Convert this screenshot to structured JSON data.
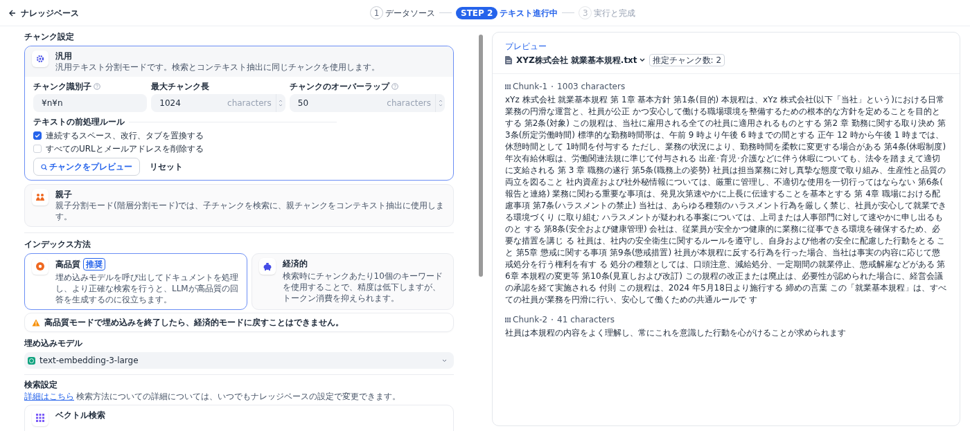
{
  "header": {
    "back_label": "ナレッジベース",
    "steps": [
      {
        "number": "1",
        "label": "データソース",
        "selected": false,
        "disabled": false
      },
      {
        "number": "STEP 2",
        "label": "テキスト進行中",
        "selected": true,
        "disabled": false
      },
      {
        "number": "3",
        "label": "実行と完成",
        "selected": false,
        "disabled": true
      }
    ]
  },
  "chunk_settings": {
    "title": "チャンク設定",
    "modes": [
      {
        "kind": "general",
        "title": "汎用",
        "description": "汎用テキスト分割モードです。検索とコンテキスト抽出に同じチャンクを使用します。",
        "selected": true,
        "fields": [
          {
            "label": "チャンク識別子",
            "help_icon": true,
            "value": "¥n¥n"
          },
          {
            "label": "最大チャンク長",
            "help_icon": false,
            "value": "1024",
            "unit": "characters"
          },
          {
            "label": "チャンクのオーバーラップ",
            "help_icon": true,
            "value": "50",
            "unit": "characters"
          }
        ],
        "rules_title": "テキストの前処理ルール",
        "rules": [
          {
            "label": "連続するスペース、改行、タブを置換する",
            "checked": true
          },
          {
            "label": "すべてのURLとメールアドレスを削除する",
            "checked": false
          }
        ],
        "preview_button": "チャンクをプレビュー",
        "reset_button": "リセット"
      },
      {
        "kind": "parent",
        "title": "親子",
        "description": "親子分割モード(階層分割モード)では、子チャンクを検索に、親チャンクをコンテキスト抽出に使用します。",
        "selected": false
      }
    ]
  },
  "index_method": {
    "title": "インデックス方法",
    "options": [
      {
        "kind": "high_quality",
        "title": "高品質",
        "badge": "推奨",
        "description": "埋め込みモデルを呼び出してドキュメントを処理し、より正確な検索を行うと、LLMが高品質の回答を生成するのに役立ちます。",
        "selected": true
      },
      {
        "kind": "economy",
        "title": "経済的",
        "description": "検索時にチャンクあたり10個のキーワードを使用することで、精度は低下しますが、トークン消費を抑えられます。",
        "selected": false
      }
    ],
    "warning": "高品質モードで埋め込みを終了したら、経済的モードに戻すことはできません。"
  },
  "embedding_model": {
    "title": "埋め込みモデル",
    "value": "text-embedding-3-large"
  },
  "retrieval": {
    "title": "検索設定",
    "link": "詳細はこちら",
    "description": "検索方法についての詳細については、いつでもナレッジベースの設定で変更できます。",
    "options": [
      {
        "title": "ベクトル検索"
      }
    ]
  },
  "preview": {
    "label": "プレビュー",
    "file_name": "XYZ株式会社 就業基本規程.txt",
    "estimate": "推定チャンク数: 2",
    "chunks": [
      {
        "title": "Chunk-1",
        "count": "1003 characters",
        "text": "xYz 株式会社 就業基本規程 第 1章 基本方針 第1条(目的) 本規程は、xYz 株式会社(以下「当社」という)における日常業務の円滑な運営と、社員が公正 かつ安心して働ける職場環境を整備するための根本的な方針を定めることを目的とする 第2条(対象) この規程は、当社に雇用される全ての社員に適用されるものとする 第2 章 勤務に関する取り決め 第3条(所定労働時間) 標準的な勤務時間帯は、午前 9 時より午後 6 時までの間とする 正午 12 時から午後 1 時までは、休憩時間として 1時間を付与する ただし、業務の状況により、勤務時間を柔軟に変更する場合がある 第4条(休暇制度) 年次有給休暇は、労働関連法規に準じて付与される 出産･育児･介護などに伴う休暇についても、法令を踏まえて適切に支給される 第 3 章 職務の遂行 第5条(職務上の姿勢) 社員は担当業務に対し真摯な態度で取り組み、生産性と品質の両立を図ること 社内資産および社外秘情報については、厳重に管理し、不適切な使用を一切行ってはならない 第6条(報告と連絡) 業務に関わる重要な事項は、発見次第速やかに上長に伝達することを基本とする 第 4章 職場における配慮事項 第7条(ハラスメントの禁止) 当社は、あらゆる種類のハラスメント行為を厳しく禁じ、社員が安心して就業できる環境づくり に取り組む ハラスメントが疑われる事案については、上司または人事部門に対して速やかに申し出るものと する 第8条(安全および健康管理) 会社は、従業員が安全かつ健康的に業務に従事できる環境を確保するため、必要な措置を講じ る 社員は、社内の安全衛生に関するルールを遵守し、自身および他者の安全に配慮した行動をとる こと 第5章 懲戒に関する事項 第9条(懲戒措置) 社員が本規程に反する行為を行った場合、当社は事実の内容に応じて懲戒処分を行う権利を有す る 処分の種類としては、口頭注意、減給処分、一定期間の就業停止、懲戒解雇などがある 第 6章 本規程の変更等 第10条(見直しおよび改訂) この規程の改正または廃止は、必要性が認められた場合に、経営会議の承認を経て実施される 付則 この規程は、2024 年5月18日より施行する 締めの言葉 この「就業基本規程」は、すべての社員が業務を円滑に行い、安心して働くための共通ルールで す"
      },
      {
        "title": "Chunk-2",
        "count": "41 characters",
        "text": "社員は本規程の内容をよく理解し、常にこれを意識した行動を心がけることが求められます"
      }
    ]
  }
}
